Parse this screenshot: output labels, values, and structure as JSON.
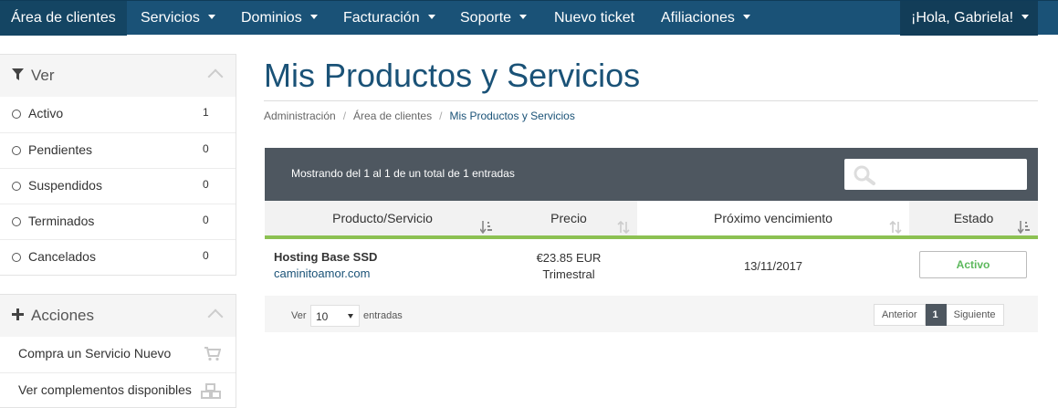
{
  "nav": {
    "items": [
      {
        "label": "Área de clientes",
        "dropdown": false
      },
      {
        "label": "Servicios",
        "dropdown": true
      },
      {
        "label": "Dominios",
        "dropdown": true
      },
      {
        "label": "Facturación",
        "dropdown": true
      },
      {
        "label": "Soporte",
        "dropdown": true
      },
      {
        "label": "Nuevo ticket",
        "dropdown": false
      },
      {
        "label": "Afiliaciones",
        "dropdown": true
      }
    ],
    "user": "¡Hola, Gabriela!"
  },
  "sidebar": {
    "view": {
      "title": "Ver",
      "filters": [
        {
          "label": "Activo",
          "count": "1"
        },
        {
          "label": "Pendientes",
          "count": "0"
        },
        {
          "label": "Suspendidos",
          "count": "0"
        },
        {
          "label": "Terminados",
          "count": "0"
        },
        {
          "label": "Cancelados",
          "count": "0"
        }
      ]
    },
    "actions": {
      "title": "Acciones",
      "items": [
        {
          "label": "Compra un Servicio Nuevo",
          "icon": "cart-icon"
        },
        {
          "label": "Ver complementos disponibles",
          "icon": "cubes-icon"
        }
      ]
    }
  },
  "main": {
    "title": "Mis Productos y Servicios",
    "breadcrumb": [
      "Administración",
      "Área de clientes",
      "Mis Productos y Servicios"
    ],
    "table": {
      "info": "Mostrando del 1 al 1 de un total de 1 entradas",
      "search_placeholder": "",
      "columns": [
        "Producto/Servicio",
        "Precio",
        "Próximo vencimiento",
        "Estado"
      ],
      "rows": [
        {
          "product": "Hosting Base SSD",
          "domain": "caminitoamor.com",
          "price": "€23.85 EUR",
          "cycle": "Trimestral",
          "due": "13/11/2017",
          "status": "Activo"
        }
      ],
      "footer": {
        "ver": "Ver",
        "length": "10",
        "entradas": "entradas",
        "prev": "Anterior",
        "page": "1",
        "next": "Siguiente"
      }
    }
  },
  "colors": {
    "nav_bg": "#1a5277",
    "accent_green": "#8cc152",
    "status_active": "#5cb85c",
    "table_header_bg": "#4e5760"
  }
}
